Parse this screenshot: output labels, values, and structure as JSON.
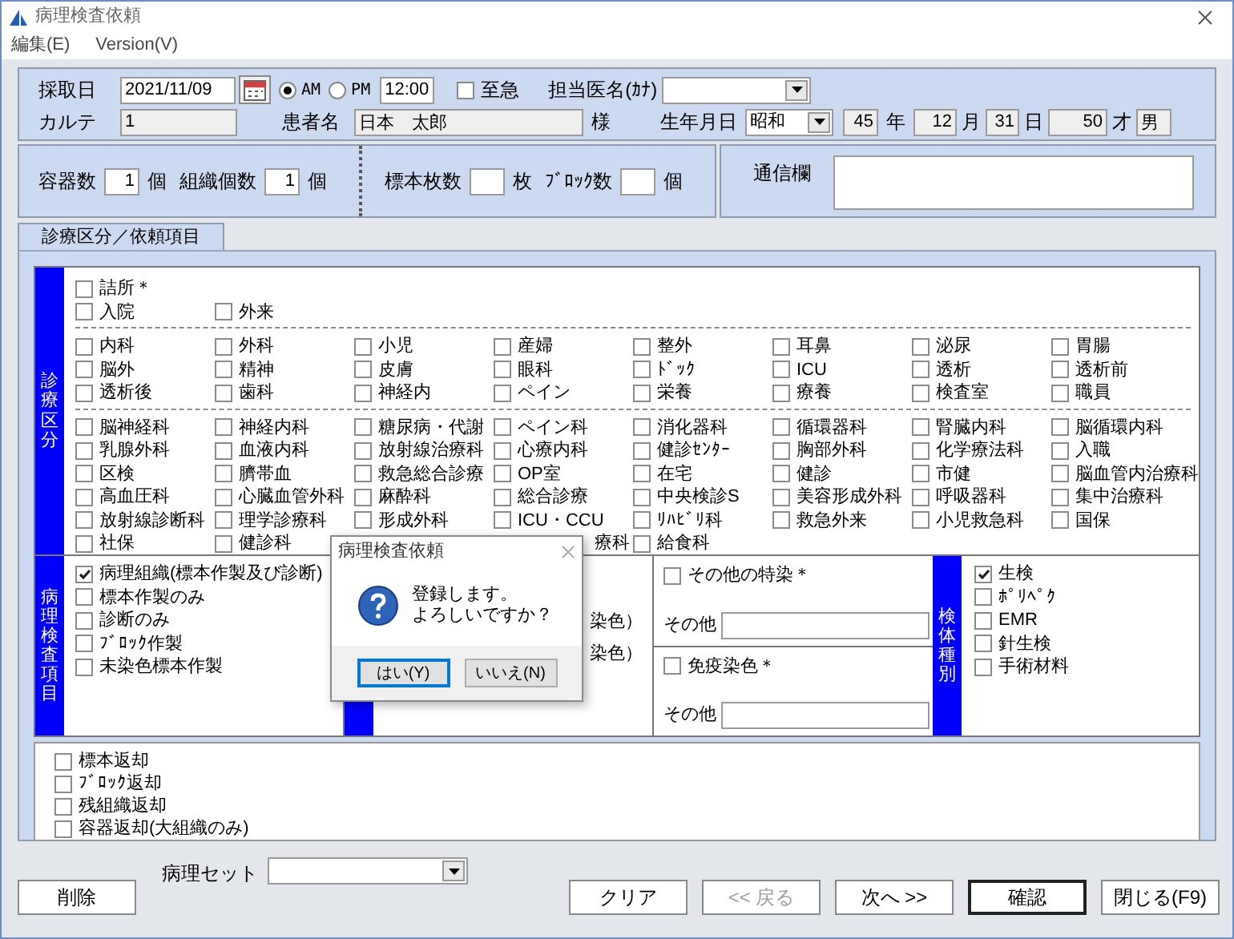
{
  "window": {
    "title": "病理検査依頼"
  },
  "menu": [
    {
      "label": "編集(E)"
    },
    {
      "label": "Version(V)"
    }
  ],
  "header": {
    "collection_date": {
      "label": "採取日",
      "value": "2021/11/09"
    },
    "period": [
      {
        "label": "AM",
        "selected": true
      },
      {
        "label": "PM",
        "selected": false
      }
    ],
    "time": "12:00",
    "urgent": {
      "label": "至急",
      "checked": false
    },
    "doctor": {
      "label": "担当医名(ｶﾅ)"
    },
    "chart": {
      "label": "カルテ",
      "value": "1"
    },
    "patient": {
      "label": "患者名",
      "value": "日本　太郎",
      "suffix": "様"
    },
    "birth": {
      "label": "生年月日",
      "era": "昭和",
      "year": "45",
      "year_unit": "年",
      "month": "12",
      "month_unit": "月",
      "day": "31",
      "day_unit": "日",
      "age": "50",
      "age_unit": "才",
      "sex": "男"
    }
  },
  "count_groups": [
    [
      {
        "label": "容器数",
        "value": "1",
        "unit": "個"
      },
      {
        "label": "組織個数",
        "value": "1",
        "unit": "個"
      }
    ],
    [
      {
        "label": "標本枚数",
        "unit": "枚"
      },
      {
        "label": "ﾌﾞﾛｯｸ数",
        "unit": "個"
      }
    ]
  ],
  "message": {
    "label": "通信欄"
  },
  "tabs": [
    {
      "label": "診療区分／依頼項目",
      "selected": true
    }
  ],
  "departments": {
    "title": "診療区分",
    "groups": [
      {
        "rows": [
          [
            {
              "kind": "checkbox",
              "label": "詰所＊",
              "checked": false
            }
          ],
          [
            {
              "kind": "checkbox",
              "label": "入院",
              "checked": false
            },
            {
              "kind": "checkbox",
              "label": "外来",
              "checked": false
            }
          ]
        ]
      },
      {
        "rows": [
          [
            {
              "kind": "checkbox",
              "label": "内科",
              "checked": false
            },
            {
              "kind": "checkbox",
              "label": "外科",
              "checked": false
            },
            {
              "kind": "checkbox",
              "label": "小児",
              "checked": false
            },
            {
              "kind": "checkbox",
              "label": "産婦",
              "checked": false
            },
            {
              "kind": "checkbox",
              "label": "整外",
              "checked": false
            },
            {
              "kind": "checkbox",
              "label": "耳鼻",
              "checked": false
            },
            {
              "kind": "checkbox",
              "label": "泌尿",
              "checked": false
            },
            {
              "kind": "checkbox",
              "label": "胃腸",
              "checked": false
            }
          ],
          [
            {
              "kind": "checkbox",
              "label": "脳外",
              "checked": false
            },
            {
              "kind": "checkbox",
              "label": "精神",
              "checked": false
            },
            {
              "kind": "checkbox",
              "label": "皮膚",
              "checked": false
            },
            {
              "kind": "checkbox",
              "label": "眼科",
              "checked": false
            },
            {
              "kind": "checkbox",
              "label": "ﾄﾞｯｸ",
              "checked": false
            },
            {
              "kind": "checkbox",
              "label": "ICU",
              "checked": false
            },
            {
              "kind": "checkbox",
              "label": "透析",
              "checked": false
            },
            {
              "kind": "checkbox",
              "label": "透析前",
              "checked": false
            }
          ],
          [
            {
              "kind": "checkbox",
              "label": "透析後",
              "checked": false
            },
            {
              "kind": "checkbox",
              "label": "歯科",
              "checked": false
            },
            {
              "kind": "checkbox",
              "label": "神経内",
              "checked": false
            },
            {
              "kind": "checkbox",
              "label": "ペイン",
              "checked": false
            },
            {
              "kind": "checkbox",
              "label": "栄養",
              "checked": false
            },
            {
              "kind": "checkbox",
              "label": "療養",
              "checked": false
            },
            {
              "kind": "checkbox",
              "label": "検査室",
              "checked": false
            },
            {
              "kind": "checkbox",
              "label": "職員",
              "checked": false
            }
          ]
        ]
      },
      {
        "rows": [
          [
            {
              "kind": "checkbox",
              "label": "脳神経科",
              "checked": false
            },
            {
              "kind": "checkbox",
              "label": "神経内科",
              "checked": false
            },
            {
              "kind": "checkbox",
              "label": "糖尿病・代謝",
              "checked": false
            },
            {
              "kind": "checkbox",
              "label": "ペイン科",
              "checked": false
            },
            {
              "kind": "checkbox",
              "label": "消化器科",
              "checked": false
            },
            {
              "kind": "checkbox",
              "label": "循環器科",
              "checked": false
            },
            {
              "kind": "checkbox",
              "label": "腎臓内科",
              "checked": false
            },
            {
              "kind": "checkbox",
              "label": "脳循環内科",
              "checked": false
            }
          ],
          [
            {
              "kind": "checkbox",
              "label": "乳腺外科",
              "checked": false
            },
            {
              "kind": "checkbox",
              "label": "血液内科",
              "checked": false
            },
            {
              "kind": "checkbox",
              "label": "放射線治療科",
              "checked": false
            },
            {
              "kind": "checkbox",
              "label": "心療内科",
              "checked": false
            },
            {
              "kind": "checkbox",
              "label": "健診ｾﾝﾀｰ",
              "checked": false
            },
            {
              "kind": "checkbox",
              "label": "胸部外科",
              "checked": false
            },
            {
              "kind": "checkbox",
              "label": "化学療法科",
              "checked": false
            },
            {
              "kind": "checkbox",
              "label": "入職",
              "checked": false
            }
          ],
          [
            {
              "kind": "checkbox",
              "label": "区検",
              "checked": false
            },
            {
              "kind": "checkbox",
              "label": "臍帯血",
              "checked": false
            },
            {
              "kind": "checkbox",
              "label": "救急総合診療",
              "checked": false
            },
            {
              "kind": "checkbox",
              "label": "OP室",
              "checked": false
            },
            {
              "kind": "checkbox",
              "label": "在宅",
              "checked": false
            },
            {
              "kind": "checkbox",
              "label": "健診",
              "checked": false
            },
            {
              "kind": "checkbox",
              "label": "市健",
              "checked": false
            },
            {
              "kind": "checkbox",
              "label": "脳血管内治療科",
              "checked": false
            }
          ],
          [
            {
              "kind": "checkbox",
              "label": "高血圧科",
              "checked": false
            },
            {
              "kind": "checkbox",
              "label": "心臓血管外科",
              "checked": false
            },
            {
              "kind": "checkbox",
              "label": "麻酔科",
              "checked": false
            },
            {
              "kind": "checkbox",
              "label": "総合診療",
              "checked": false
            },
            {
              "kind": "checkbox",
              "label": "中央検診S",
              "checked": false
            },
            {
              "kind": "checkbox",
              "label": "美容形成外科",
              "checked": false
            },
            {
              "kind": "checkbox",
              "label": "呼吸器科",
              "checked": false
            },
            {
              "kind": "checkbox",
              "label": "集中治療科",
              "checked": false
            }
          ],
          [
            {
              "kind": "checkbox",
              "label": "放射線診断科",
              "checked": false
            },
            {
              "kind": "checkbox",
              "label": "理学診療科",
              "checked": false
            },
            {
              "kind": "checkbox",
              "label": "形成外科",
              "checked": false
            },
            {
              "kind": "checkbox",
              "label": "ICU・CCU",
              "checked": false
            },
            {
              "kind": "checkbox",
              "label": "ﾘﾊﾋﾞﾘ科",
              "checked": false
            },
            {
              "kind": "checkbox",
              "label": "救急外来",
              "checked": false
            },
            {
              "kind": "checkbox",
              "label": "小児救急科",
              "checked": false
            },
            {
              "kind": "checkbox",
              "label": "国保",
              "checked": false
            }
          ],
          [
            {
              "kind": "checkbox",
              "label": "社保",
              "checked": false
            },
            {
              "kind": "checkbox",
              "label": "健診科",
              "checked": false
            },
            null,
            {
              "kind": "partial",
              "label": "療科"
            },
            {
              "kind": "checkbox",
              "label": "給食科",
              "checked": false
            }
          ]
        ]
      }
    ]
  },
  "pathology": {
    "title": "病理検査項目",
    "items": [
      {
        "label": "病理組織(標本作製及び診断)",
        "checked": true
      },
      {
        "label": "標本作製のみ",
        "checked": false
      },
      {
        "label": "診断のみ",
        "checked": false
      },
      {
        "label": "ﾌﾞﾛｯｸ作製",
        "checked": false
      },
      {
        "label": "未染色標本作製",
        "checked": false
      }
    ]
  },
  "stains": {
    "items": [
      {
        "label": "染色）"
      },
      {
        "label": "染色）"
      }
    ]
  },
  "special_stains": [
    {
      "label": "その他の特染＊",
      "checked": false,
      "other_label": "その他"
    },
    {
      "label": "免疫染色＊",
      "checked": false,
      "other_label": "その他"
    }
  ],
  "specimen": {
    "title": "検体種別",
    "items": [
      {
        "label": "生検",
        "checked": true
      },
      {
        "label": "ﾎﾟﾘﾍﾟｸ",
        "checked": false
      },
      {
        "label": "EMR",
        "checked": false
      },
      {
        "label": "針生検",
        "checked": false
      },
      {
        "label": "手術材料",
        "checked": false
      }
    ]
  },
  "returns": [
    {
      "label": "標本返却",
      "checked": false
    },
    {
      "label": "ﾌﾞﾛｯｸ返却",
      "checked": false
    },
    {
      "label": "残組織返却",
      "checked": false
    },
    {
      "label": "容器返却(大組織のみ)",
      "checked": false
    }
  ],
  "footer": {
    "delete": "削除",
    "set_label": "病理セット",
    "buttons": [
      {
        "label": "クリア",
        "disabled": false,
        "default": false
      },
      {
        "label": "<< 戻る",
        "disabled": true,
        "default": false
      },
      {
        "label": "次へ >>",
        "disabled": false,
        "default": false
      },
      {
        "label": "確認",
        "disabled": false,
        "default": true
      },
      {
        "label": "閉じる(F9)",
        "disabled": false,
        "default": false
      }
    ]
  },
  "dialog": {
    "title": "病理検査依頼",
    "message": [
      "登録します。",
      "よろしいですか？"
    ],
    "buttons": [
      {
        "label": "はい(Y)",
        "focused": true
      },
      {
        "label": "いいえ(N)",
        "focused": false
      }
    ]
  }
}
